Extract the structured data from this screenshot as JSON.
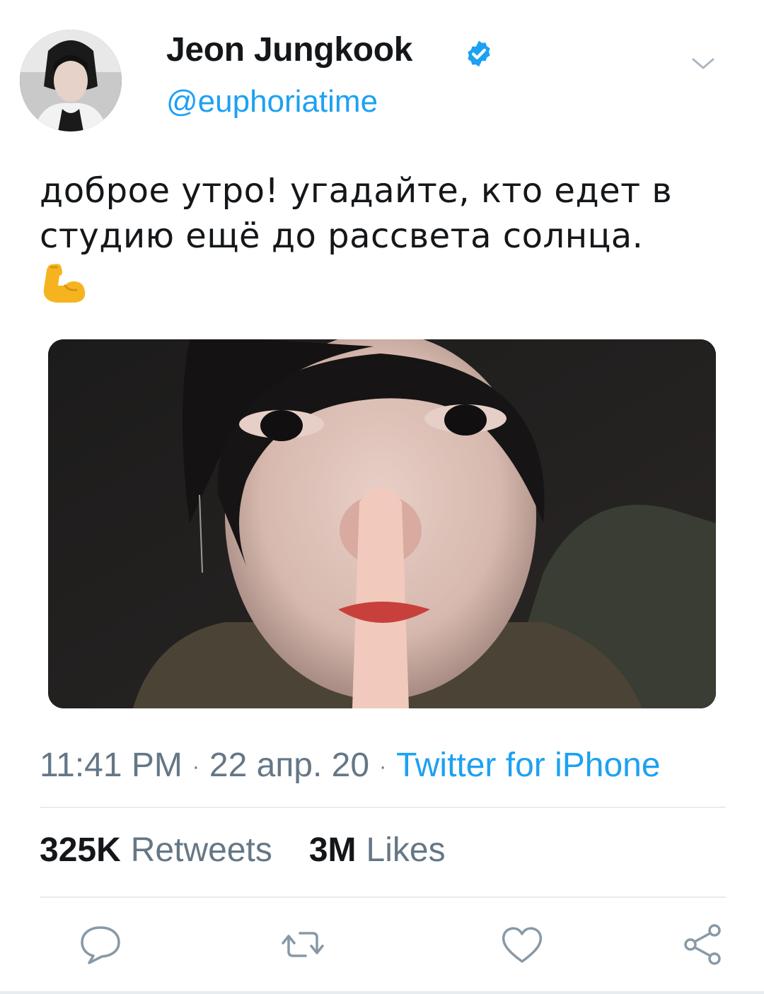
{
  "user": {
    "display_name": "Jeon Jungkook",
    "handle": "@euphoriatime",
    "verified": true
  },
  "tweet": {
    "text_lines": [
      "доброе утро! угадайте, кто едет в",
      "студию ещё до рассвета солнца."
    ],
    "emoji": "flexed-biceps"
  },
  "meta": {
    "time": "11:41 PM",
    "separator": "·",
    "date": "22 апр. 20",
    "source": "Twitter for iPhone"
  },
  "stats": {
    "retweets_count": "325K",
    "retweets_label": "Retweets",
    "likes_count": "3M",
    "likes_label": "Likes"
  },
  "actions": [
    "reply-icon",
    "retweet-icon",
    "like-icon",
    "share-icon"
  ],
  "colors": {
    "accent": "#1da1f2",
    "text": "#14171a",
    "secondary": "#657786",
    "divider": "#e6ecf0"
  }
}
